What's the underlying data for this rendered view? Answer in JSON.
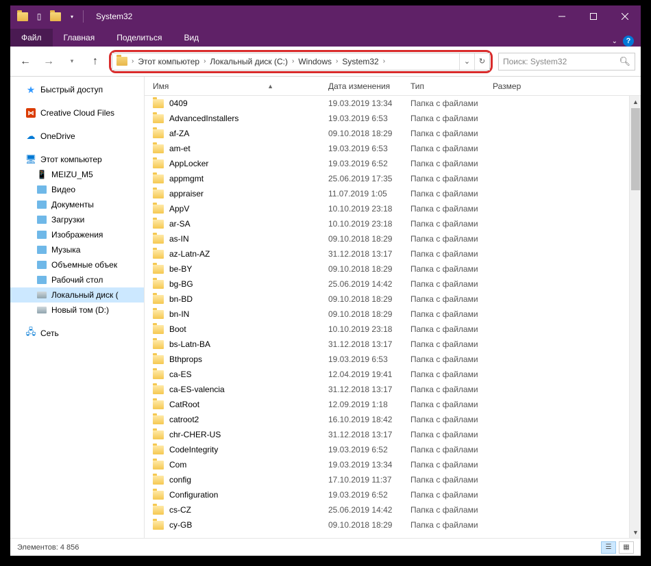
{
  "title": "System32",
  "tabs": {
    "file": "Файл",
    "home": "Главная",
    "share": "Поделиться",
    "view": "Вид"
  },
  "breadcrumb": [
    "Этот компьютер",
    "Локальный диск (C:)",
    "Windows",
    "System32"
  ],
  "search": {
    "placeholder": "Поиск: System32"
  },
  "columns": {
    "name": "Имя",
    "date": "Дата изменения",
    "type": "Тип",
    "size": "Размер"
  },
  "sidebar": {
    "quick": "Быстрый доступ",
    "cc": "Creative Cloud Files",
    "onedrive": "OneDrive",
    "pc": "Этот компьютер",
    "pc_children": [
      {
        "label": "MEIZU_M5",
        "icon": "phone"
      },
      {
        "label": "Видео",
        "icon": "generic"
      },
      {
        "label": "Документы",
        "icon": "generic"
      },
      {
        "label": "Загрузки",
        "icon": "generic"
      },
      {
        "label": "Изображения",
        "icon": "generic"
      },
      {
        "label": "Музыка",
        "icon": "generic"
      },
      {
        "label": "Объемные объек",
        "icon": "generic"
      },
      {
        "label": "Рабочий стол",
        "icon": "generic"
      },
      {
        "label": "Локальный диск (",
        "icon": "disk",
        "selected": true
      },
      {
        "label": "Новый том (D:)",
        "icon": "disk"
      }
    ],
    "network": "Сеть"
  },
  "files": [
    {
      "name": "0409",
      "date": "19.03.2019 13:34",
      "type": "Папка с файлами"
    },
    {
      "name": "AdvancedInstallers",
      "date": "19.03.2019 6:53",
      "type": "Папка с файлами"
    },
    {
      "name": "af-ZA",
      "date": "09.10.2018 18:29",
      "type": "Папка с файлами"
    },
    {
      "name": "am-et",
      "date": "19.03.2019 6:53",
      "type": "Папка с файлами"
    },
    {
      "name": "AppLocker",
      "date": "19.03.2019 6:52",
      "type": "Папка с файлами"
    },
    {
      "name": "appmgmt",
      "date": "25.06.2019 17:35",
      "type": "Папка с файлами"
    },
    {
      "name": "appraiser",
      "date": "11.07.2019 1:05",
      "type": "Папка с файлами"
    },
    {
      "name": "AppV",
      "date": "10.10.2019 23:18",
      "type": "Папка с файлами"
    },
    {
      "name": "ar-SA",
      "date": "10.10.2019 23:18",
      "type": "Папка с файлами"
    },
    {
      "name": "as-IN",
      "date": "09.10.2018 18:29",
      "type": "Папка с файлами"
    },
    {
      "name": "az-Latn-AZ",
      "date": "31.12.2018 13:17",
      "type": "Папка с файлами"
    },
    {
      "name": "be-BY",
      "date": "09.10.2018 18:29",
      "type": "Папка с файлами"
    },
    {
      "name": "bg-BG",
      "date": "25.06.2019 14:42",
      "type": "Папка с файлами"
    },
    {
      "name": "bn-BD",
      "date": "09.10.2018 18:29",
      "type": "Папка с файлами"
    },
    {
      "name": "bn-IN",
      "date": "09.10.2018 18:29",
      "type": "Папка с файлами"
    },
    {
      "name": "Boot",
      "date": "10.10.2019 23:18",
      "type": "Папка с файлами"
    },
    {
      "name": "bs-Latn-BA",
      "date": "31.12.2018 13:17",
      "type": "Папка с файлами"
    },
    {
      "name": "Bthprops",
      "date": "19.03.2019 6:53",
      "type": "Папка с файлами"
    },
    {
      "name": "ca-ES",
      "date": "12.04.2019 19:41",
      "type": "Папка с файлами"
    },
    {
      "name": "ca-ES-valencia",
      "date": "31.12.2018 13:17",
      "type": "Папка с файлами"
    },
    {
      "name": "CatRoot",
      "date": "12.09.2019 1:18",
      "type": "Папка с файлами"
    },
    {
      "name": "catroot2",
      "date": "16.10.2019 18:42",
      "type": "Папка с файлами"
    },
    {
      "name": "chr-CHER-US",
      "date": "31.12.2018 13:17",
      "type": "Папка с файлами"
    },
    {
      "name": "CodeIntegrity",
      "date": "19.03.2019 6:52",
      "type": "Папка с файлами"
    },
    {
      "name": "Com",
      "date": "19.03.2019 13:34",
      "type": "Папка с файлами"
    },
    {
      "name": "config",
      "date": "17.10.2019 11:37",
      "type": "Папка с файлами"
    },
    {
      "name": "Configuration",
      "date": "19.03.2019 6:52",
      "type": "Папка с файлами"
    },
    {
      "name": "cs-CZ",
      "date": "25.06.2019 14:42",
      "type": "Папка с файлами"
    },
    {
      "name": "cy-GB",
      "date": "09.10.2018 18:29",
      "type": "Папка с файлами"
    }
  ],
  "status": {
    "count_label": "Элементов:",
    "count": "4 856"
  }
}
